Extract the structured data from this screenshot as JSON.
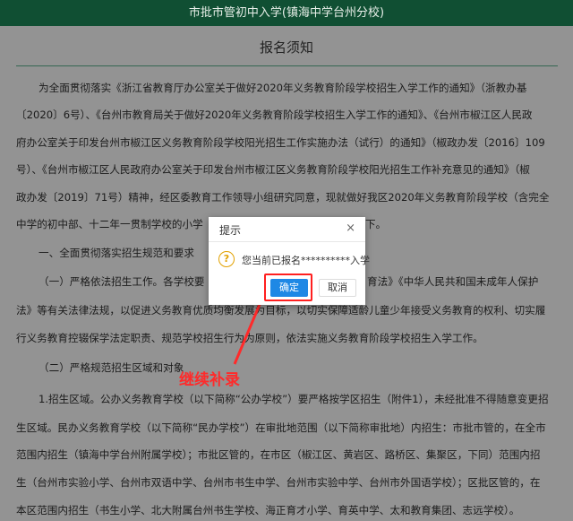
{
  "header": {
    "title": "市批市管初中入学(镇海中学台州分校)"
  },
  "document": {
    "title": "报名须知",
    "lines": [
      "为全面贯彻落实《浙江省教育厅办公室关于做好2020年义务教育阶段学校招生入学工作的通知》（浙教办基",
      "〔2020〕6号）、《台州市教育局关于做好2020年义务教育阶段学校招生入学工作的通知》、《台州市椒江区人民政",
      "府办公室关于印发台州市椒江区义务教育阶段学校阳光招生工作实施办法（试行）的通知》（椒政办发〔2016〕109",
      "号）、《台州市椒江区人民政府办公室关于印发台州市椒江区义务教育阶段学校阳光招生工作补充意见的通知》（椒",
      "政办发〔2019〕71号）精神，经区委教育工作领导小组研究同意，现就做好我区2020年义务教育阶段学校（含完全",
      "中学的初中部、十二年一贯制学校的小学",
      "下。",
      "一、全面贯彻落实招生规范和要求",
      "（一）严格依法招生工作。各学校要",
      "育法》《中华人民共和国未成年人保护",
      "法》等有关法律法规，以促进义务教育优质均衡发展为目标，以切实保障适龄儿童少年接受义务教育的权利、切实履",
      "行义务教育控辍保学法定职责、规范学校招生行为为原则，依法实施义务教育阶段学校招生入学工作。",
      "（二）严格规范招生区域和对象",
      "1.招生区域。公办义务教育学校（以下简称“公办学校”）要严格按学区招生（附件1），未经批准不得随意变更招",
      "生区域。民办义务教育学校（以下简称“民办学校”）在审批地范围（以下简称审批地）内招生：市批市管的，在全市",
      "范围内招生（镇海中学台州附属学校）；市批区管的，在市区（椒江区、黄岩区、路桥区、集聚区，下同）范围内招",
      "生（台州市实验小学、台州市双语中学、台州市书生中学、台州市实验中学、台州市外国语学校）；区批区管的，在",
      "本区范围内招生（书生小学、北大附属台州书生学校、海正育才小学、育英中学、太和教育集团、志远学校）。"
    ]
  },
  "annotation": {
    "text": "继续补录",
    "color": "#ff2a2a"
  },
  "dialog": {
    "title": "提示",
    "close": "×",
    "icon": "question-icon",
    "icon_glyph": "?",
    "message": "您当前已报名**********入学",
    "ok_label": "确定",
    "cancel_label": "取消"
  }
}
